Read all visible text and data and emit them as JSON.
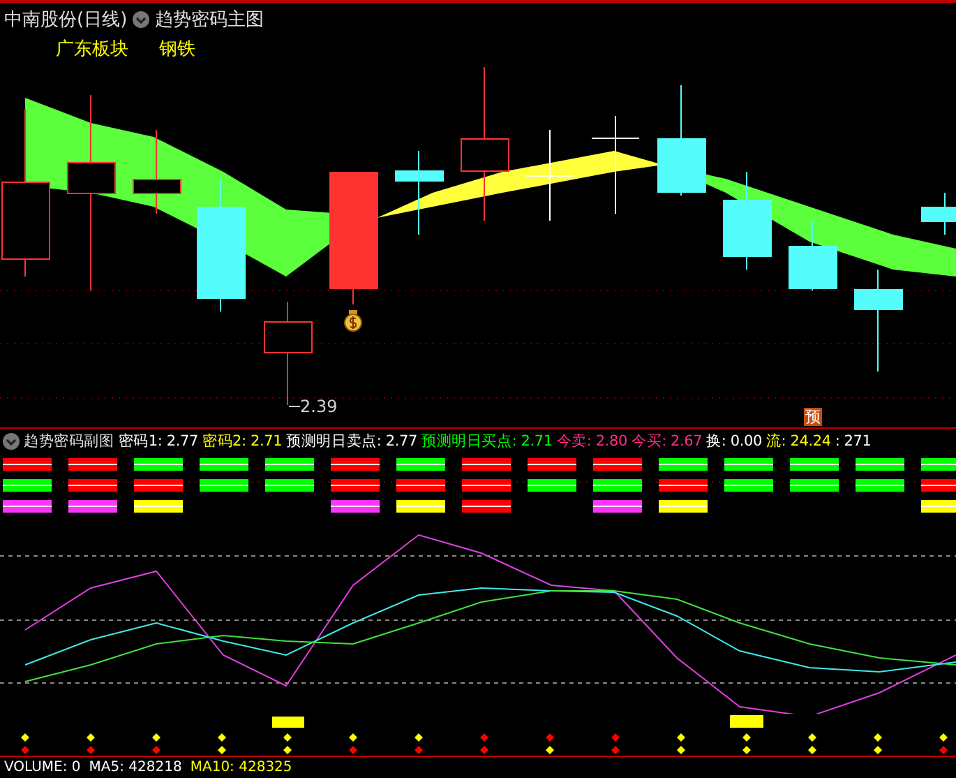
{
  "main_chart": {
    "title": "中南股份(日线)",
    "indicator": "趋势密码主图",
    "tags": [
      {
        "label": "广东板块"
      },
      {
        "label": "钢铁"
      }
    ],
    "low_label": "2.39",
    "badge": "预"
  },
  "sub_chart": {
    "title": "趋势密码副图",
    "stats": [
      {
        "text": "密码1: 2.77",
        "color": "#ffffff"
      },
      {
        "text": "密码2: 2.71",
        "color": "#ffff00"
      },
      {
        "text": "预测明日卖点: 2.77",
        "color": "#ffffff"
      },
      {
        "text": "预测明日买点: 2.71",
        "color": "#00ff00"
      },
      {
        "text": "今卖: 2.80",
        "color": "#ff2d8c"
      },
      {
        "text": "今买: 2.67",
        "color": "#ff2d8c"
      },
      {
        "text": "换: 0.00",
        "color": "#ffffff"
      },
      {
        "text": "流: 24.24",
        "color": "#ffff00"
      },
      {
        "text": ": 271",
        "color": "#ffffff"
      }
    ]
  },
  "volume_bar": {
    "stats": [
      {
        "text": "VOLUME: 0",
        "color": "#ffffff"
      },
      {
        "text": "MA5: 428218",
        "color": "#ffffff"
      },
      {
        "text": "MA10: 428325",
        "color": "#ffff00"
      }
    ]
  }
}
